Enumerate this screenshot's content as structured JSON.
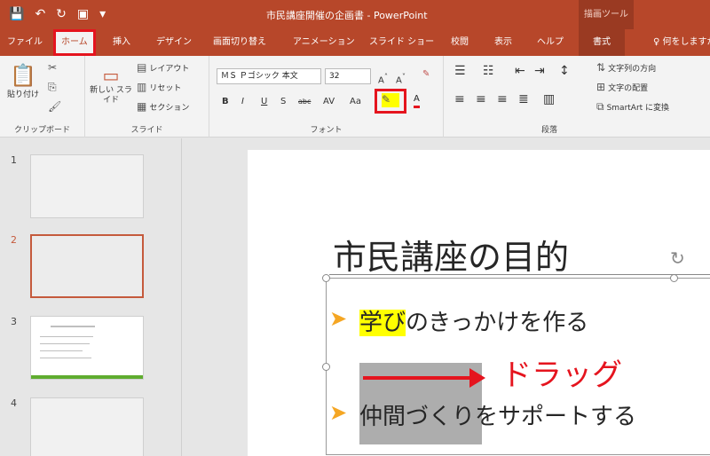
{
  "window": {
    "title": "市民講座開催の企画書  -  PowerPoint",
    "context_header": "描画ツール"
  },
  "tabs": [
    {
      "label": "ファイル"
    },
    {
      "label": "ホーム"
    },
    {
      "label": "挿入"
    },
    {
      "label": "デザイン"
    },
    {
      "label": "画面切り替え"
    },
    {
      "label": "アニメーション"
    },
    {
      "label": "スライド ショー"
    },
    {
      "label": "校閲"
    },
    {
      "label": "表示"
    },
    {
      "label": "ヘルプ"
    },
    {
      "label": "書式"
    },
    {
      "label": "何をしますか"
    }
  ],
  "ribbon": {
    "clipboard": {
      "paste": "貼り付け",
      "group": "クリップボード"
    },
    "slides": {
      "new_slide": "新しい スライド",
      "layout": "レイアウト",
      "reset": "リセット",
      "section": "セクション",
      "group": "スライド"
    },
    "font": {
      "font_name": "ＭＳ Ｐゴシック 本文",
      "font_size": "32",
      "group": "フォント",
      "case_label": "Aa"
    },
    "paragraph": {
      "group": "段落",
      "text_direction": "文字列の方向",
      "align_text": "文字の配置",
      "smartart": "SmartArt に変換"
    }
  },
  "slides": [
    {
      "number": "1"
    },
    {
      "number": "2"
    },
    {
      "number": "3"
    },
    {
      "number": "4"
    }
  ],
  "slide": {
    "title": "市民講座の目的",
    "bullet1_highlight": "学び",
    "bullet1_rest": "のきっかけを作る",
    "bullet2": "仲間づくりをサポートする",
    "drag_label": "ドラッグ"
  },
  "colors": {
    "accent": "#b7472a",
    "highlight_box": "#e5141e",
    "bullet": "#f5a623",
    "text_highlight": "#ffff00"
  }
}
